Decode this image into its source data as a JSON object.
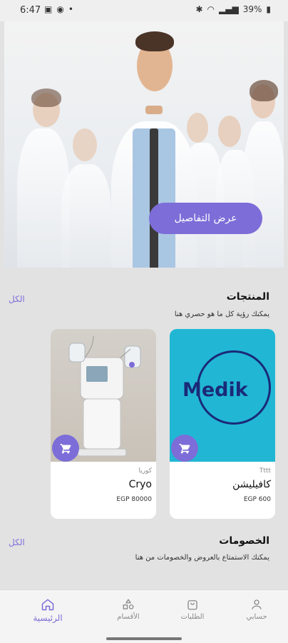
{
  "status_bar": {
    "time": "6:47",
    "battery": "39%"
  },
  "hero": {
    "button_label": "عرض التفاصيل"
  },
  "products": {
    "title": "المنتجات",
    "subtitle": "يمكنك رؤية كل ما هو حصري هنا",
    "see_all": "الكل",
    "items": [
      {
        "category": "Tttt",
        "name": "كافيليشن",
        "price": "EGP 600",
        "logo_text": "Medik"
      },
      {
        "category": "كوريا",
        "name": "Cryo",
        "price": "EGP 80000"
      }
    ]
  },
  "discounts": {
    "title": "الخصومات",
    "subtitle": "يمكنك الاستمتاع بالعروض والخصومات من هنا",
    "see_all": "الكل"
  },
  "tabbar": {
    "items": [
      {
        "label": "حسابي",
        "icon": "person-icon"
      },
      {
        "label": "الطلبات",
        "icon": "bag-icon"
      },
      {
        "label": "الأقسام",
        "icon": "shapes-icon"
      },
      {
        "label": "الرئيسية",
        "icon": "home-icon",
        "active": true
      }
    ]
  },
  "colors": {
    "accent": "#7c6dd8",
    "medik_bg": "#21b7d4",
    "medik_text": "#1a2a78"
  }
}
